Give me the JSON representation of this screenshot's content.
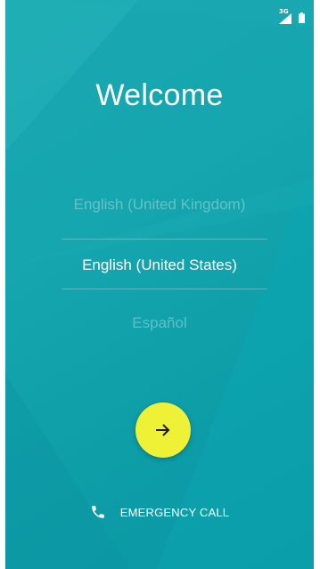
{
  "status_bar": {
    "network_type": "3G",
    "signal_icon": "signal-icon",
    "battery_icon": "battery-icon"
  },
  "welcome": {
    "title": "Welcome"
  },
  "language_picker": {
    "options": [
      {
        "label": "English (United Kingdom)",
        "selected": false
      },
      {
        "label": "English (United States)",
        "selected": true
      },
      {
        "label": "Español",
        "selected": false
      }
    ]
  },
  "next_button": {
    "icon": "arrow-right-icon",
    "color": "#eef135"
  },
  "emergency": {
    "icon": "phone-icon",
    "label": "EMERGENCY CALL"
  },
  "colors": {
    "background": "#16a6af",
    "accent": "#eef135"
  }
}
